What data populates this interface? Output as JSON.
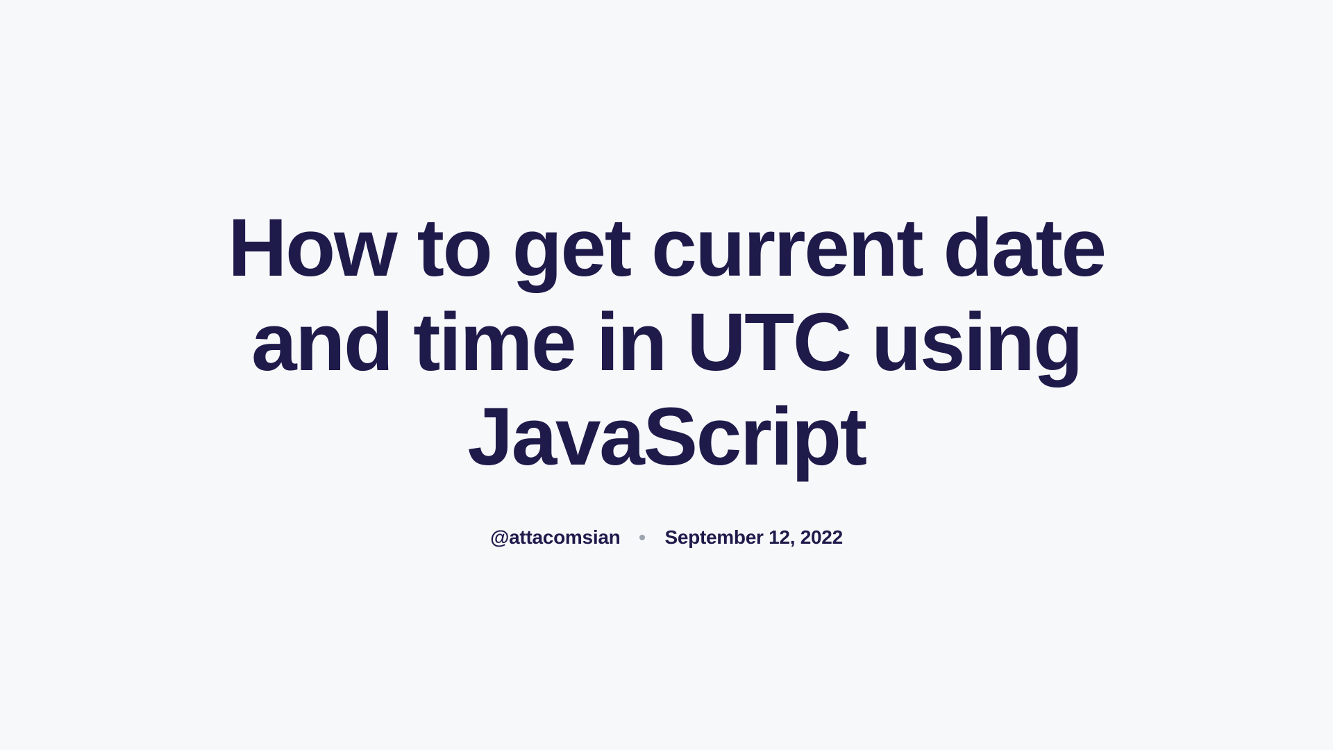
{
  "article": {
    "title": "How to get current date and time in UTC using JavaScript",
    "author": "@attacomsian",
    "date": "September 12, 2022"
  }
}
